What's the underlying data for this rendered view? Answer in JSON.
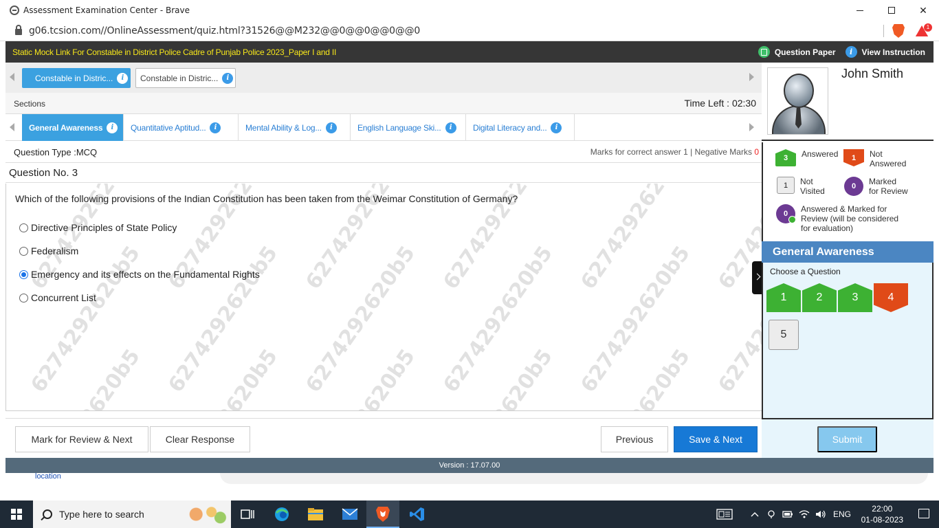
{
  "browser": {
    "window_title": "Assessment Examination Center - Brave",
    "url": "g06.tcsion.com//OnlineAssessment/quiz.html?31526@@M232@@0@@0@@0@@0",
    "reward_count": "1"
  },
  "exam_header": {
    "title": "Static Mock Link For Constable in District Police Cadre of Punjab Police 2023_Paper I and II",
    "question_paper_label": "Question Paper",
    "view_instruction_label": "View Instruction"
  },
  "test_tabs": [
    {
      "label": "Constable in Distric...",
      "active": true
    },
    {
      "label": "Constable in Distric...",
      "active": false
    }
  ],
  "sections_label": "Sections",
  "time_left": "Time Left : 02:30",
  "section_tabs": [
    {
      "label": "General Awareness",
      "active": true
    },
    {
      "label": "Quantitative Aptitud...",
      "active": false
    },
    {
      "label": "Mental Ability & Log...",
      "active": false
    },
    {
      "label": "English Language Ski...",
      "active": false
    },
    {
      "label": "Digital Literacy and...",
      "active": false
    }
  ],
  "question_type": "Question Type :MCQ",
  "marks": {
    "correct_label": "Marks for correct answer",
    "correct_value": "1",
    "separator": "|",
    "negative_label": "Negative Marks",
    "negative_value": "0"
  },
  "question_number": "Question No. 3",
  "question_text": "Which of the following provisions of the Indian Constitution has been taken from the Weimar Constitution of Germany?",
  "options": [
    {
      "label": "Directive Principles of State Policy",
      "selected": false
    },
    {
      "label": "Federalism",
      "selected": false
    },
    {
      "label": "Emergency and its effects on the Fundamental Rights",
      "selected": true
    },
    {
      "label": "Concurrent List",
      "selected": false
    }
  ],
  "watermark_text": "6274292620b5",
  "buttons": {
    "mark_review_next": "Mark for Review & Next",
    "clear_response": "Clear Response",
    "previous": "Previous",
    "save_next": "Save & Next",
    "submit": "Submit"
  },
  "candidate": {
    "name": "John Smith"
  },
  "legend": {
    "answered": {
      "count": "3",
      "label": "Answered"
    },
    "not_answered": {
      "count": "1",
      "label_line1": "Not",
      "label_line2": "Answered"
    },
    "not_visited": {
      "count": "1",
      "label_line1": "Not",
      "label_line2": "Visited"
    },
    "marked_review": {
      "count": "0",
      "label_line1": "Marked",
      "label_line2": "for Review"
    },
    "answered_marked": {
      "count": "0",
      "label_line1": "Answered & Marked for",
      "label_line2": "Review (will be considered",
      "label_line3": "for evaluation)"
    }
  },
  "palette": {
    "section_name": "General Awareness",
    "choose_label": "Choose a Question",
    "questions": [
      {
        "number": "1",
        "status": "answered"
      },
      {
        "number": "2",
        "status": "answered"
      },
      {
        "number": "3",
        "status": "answered"
      },
      {
        "number": "4",
        "status": "not-answered"
      },
      {
        "number": "5",
        "status": "not-visited"
      }
    ]
  },
  "version": "Version : 17.07.00",
  "behind_page": {
    "link_text": "location"
  },
  "taskbar": {
    "search_placeholder": "Type here to search",
    "language": "ENG",
    "time": "22:00",
    "date": "01-08-2023"
  }
}
